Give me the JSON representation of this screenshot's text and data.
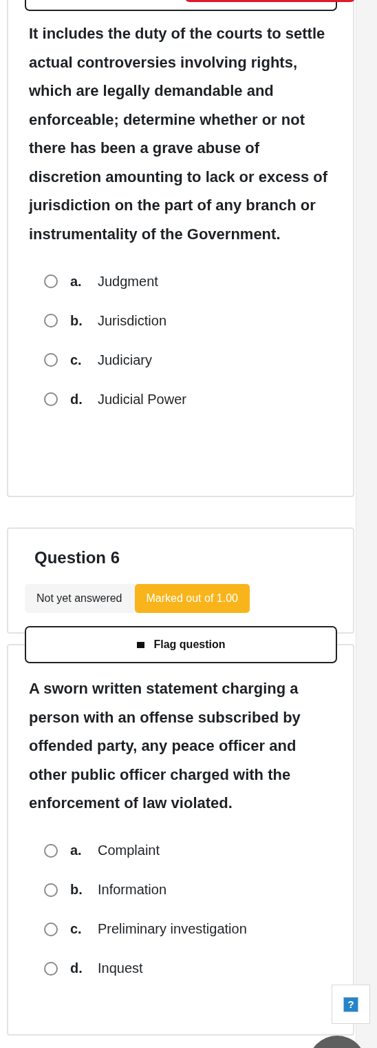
{
  "questions": [
    {
      "prompt": "It includes the duty of the courts to settle actual controversies involving rights, which are legally demandable and enforceable; determine whether or not there has been a grave abuse of discretion amounting to lack or excess of jurisdiction on the part of any branch or instrumentality of the Government.",
      "options": [
        {
          "letter": "a.",
          "text": "Judgment",
          "selected": false
        },
        {
          "letter": "b.",
          "text": "Jurisdiction",
          "selected": false
        },
        {
          "letter": "c.",
          "text": "Judiciary",
          "selected": false
        },
        {
          "letter": "d.",
          "text": "Judicial Power",
          "selected": false
        }
      ]
    },
    {
      "title": "Question 6",
      "status": "Not yet answered",
      "marks": "Marked out of 1.00",
      "flag_label": "Flag question",
      "prompt": "A sworn written statement charging a person with an offense subscribed by offended party, any peace officer and other public officer charged with the enforcement of law violated.",
      "options": [
        {
          "letter": "a.",
          "text": "Complaint",
          "selected": false
        },
        {
          "letter": "b.",
          "text": "Information",
          "selected": false
        },
        {
          "letter": "c.",
          "text": "Preliminary investigation",
          "selected": false
        },
        {
          "letter": "d.",
          "text": "Inquest",
          "selected": false
        }
      ]
    }
  ],
  "help": {
    "label": "?"
  }
}
